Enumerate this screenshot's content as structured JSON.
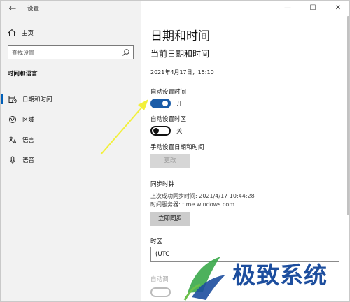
{
  "app": {
    "title": "设置"
  },
  "window_controls": {
    "minimize": "—",
    "maximize": "☐",
    "close": "✕"
  },
  "sidebar": {
    "back": "←",
    "home_label": "主页",
    "search_placeholder": "查找设置",
    "section_heading": "时间和语言",
    "items": [
      {
        "label": "日期和时间",
        "icon": "calendar-clock-icon",
        "selected": true
      },
      {
        "label": "区域",
        "icon": "globe-region-icon",
        "selected": false
      },
      {
        "label": "语言",
        "icon": "language-icon",
        "selected": false
      },
      {
        "label": "语音",
        "icon": "microphone-icon",
        "selected": false
      }
    ]
  },
  "main": {
    "page_title": "日期和时间",
    "sub_title": "当前日期和时间",
    "current_datetime": "2021年4月17日，15:10",
    "auto_time": {
      "label": "自动设置时间",
      "state": "开",
      "on": true
    },
    "auto_timezone": {
      "label": "自动设置时区",
      "state": "关",
      "on": false
    },
    "manual": {
      "label": "手动设置日期和时间",
      "button": "更改"
    },
    "sync": {
      "label": "同步时钟",
      "last_sync": "上次成功同步时间: 2021/4/17 10:44:28",
      "server": "时间服务器: time.windows.com",
      "button": "立即同步"
    },
    "timezone": {
      "label": "时区",
      "value": "(UTC"
    },
    "faded_label": "自动调"
  },
  "watermark": {
    "text": "极致系统"
  },
  "colors": {
    "accent": "#1a5ca8",
    "sidebar_bg": "#f2f2f2",
    "watermark": "#1d4e9e",
    "arrow": "#f2f03a"
  }
}
